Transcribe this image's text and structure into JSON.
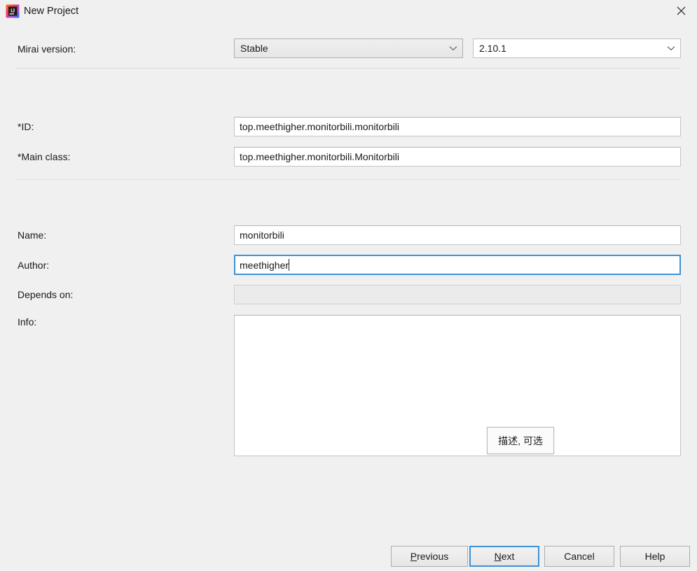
{
  "window": {
    "title": "New Project",
    "app_icon": "intellij-idea-icon",
    "close_icon": "close-icon",
    "background_color": "#f0f0f0"
  },
  "form": {
    "mirai_version": {
      "label": "Mirai version:",
      "channel": {
        "value": "Stable",
        "arrow_icon": "chevron-down-icon"
      },
      "version": {
        "value": "2.10.1",
        "arrow_icon": "chevron-down-icon"
      }
    },
    "id": {
      "label": "*ID:",
      "value": "top.meethigher.monitorbili.monitorbili"
    },
    "main_class": {
      "label": "*Main class:",
      "value": "top.meethigher.monitorbili.Monitorbili"
    },
    "name": {
      "label": "Name:",
      "value": "monitorbili"
    },
    "author": {
      "label": "Author:",
      "value": "meethigher",
      "focused": true
    },
    "depends_on": {
      "label": "Depends on:",
      "value": "",
      "disabled": true
    },
    "info": {
      "label": "Info:",
      "value": ""
    }
  },
  "tooltip": {
    "text": "描述, 可选"
  },
  "footer": {
    "previous": {
      "prefix": "",
      "mnemonic": "P",
      "suffix": "revious"
    },
    "next": {
      "prefix": "",
      "mnemonic": "N",
      "suffix": "ext",
      "is_default": true
    },
    "cancel": {
      "label": "Cancel"
    },
    "help": {
      "label": "Help"
    }
  },
  "colors": {
    "focus_blue": "#3d92d8",
    "dialog_bg": "#f0f0f0",
    "field_bg": "#ffffff",
    "disabled_bg": "#ebebeb"
  }
}
